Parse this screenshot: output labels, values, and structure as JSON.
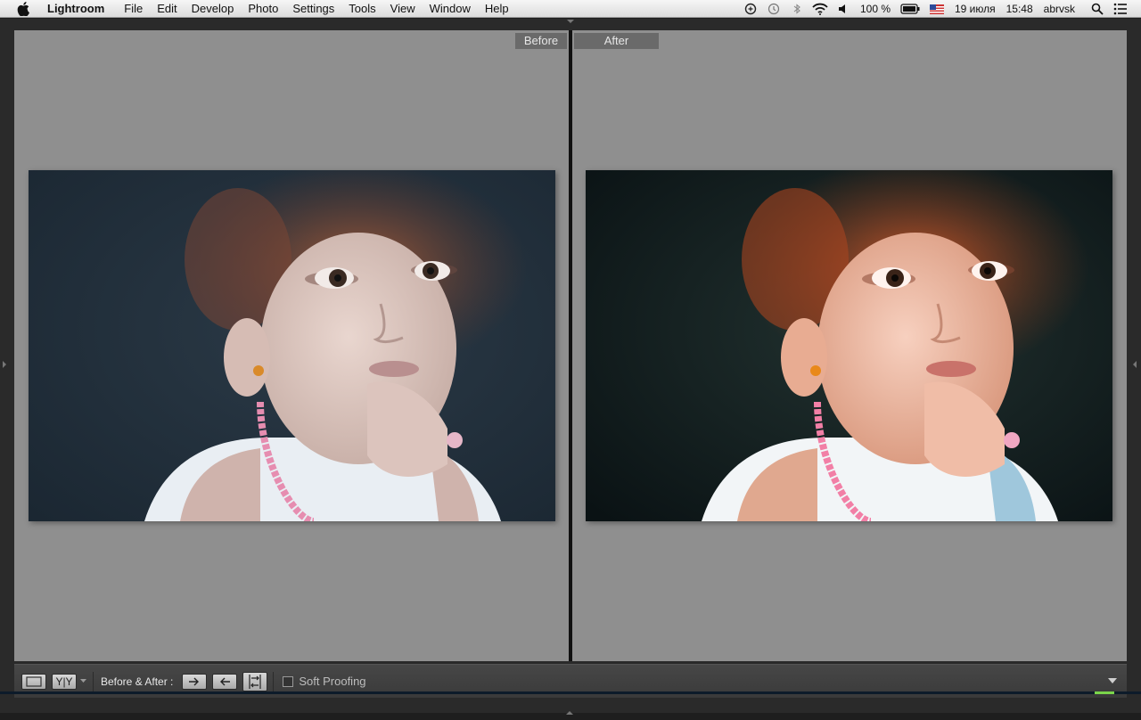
{
  "menubar": {
    "app_name": "Lightroom",
    "items": [
      "File",
      "Edit",
      "Develop",
      "Photo",
      "Settings",
      "Tools",
      "View",
      "Window",
      "Help"
    ],
    "battery": "100 %",
    "date": "19 июля",
    "time": "15:48",
    "user": "abrvsk"
  },
  "compare": {
    "before_label": "Before",
    "after_label": "After"
  },
  "toolbar": {
    "yy_label": "Y|Y",
    "before_after_label": "Before & After :",
    "soft_proofing_label": "Soft Proofing",
    "soft_proofing_checked": false
  }
}
